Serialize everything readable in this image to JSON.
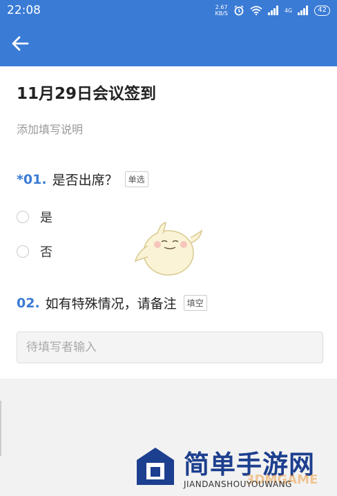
{
  "status_bar": {
    "time": "22:08",
    "net_speed_value": "2.67",
    "net_speed_unit": "KB/S",
    "signal_label": "4G",
    "battery": "42"
  },
  "form": {
    "title": "11月29日会议签到",
    "description": "添加填写说明"
  },
  "questions": [
    {
      "number": "*01.",
      "text": "是否出席？",
      "tag": "单选",
      "options": [
        "是",
        "否"
      ]
    },
    {
      "number": "02.",
      "text": "如有特殊情况，请备注",
      "tag": "填空",
      "placeholder": "待填写者输入"
    }
  ],
  "watermark": {
    "site_name": "简单手游网",
    "site_pinyin": "JIANDANSHOUYOUWANG",
    "overlay_text": "3DMGAME"
  },
  "colors": {
    "primary": "#3a7bd5",
    "watermark_blue": "#1d3f8f"
  },
  "icons": {
    "back": "arrow-left-icon",
    "alarm": "alarm-clock-icon",
    "wifi": "wifi-icon",
    "signal": "signal-bars-icon"
  }
}
